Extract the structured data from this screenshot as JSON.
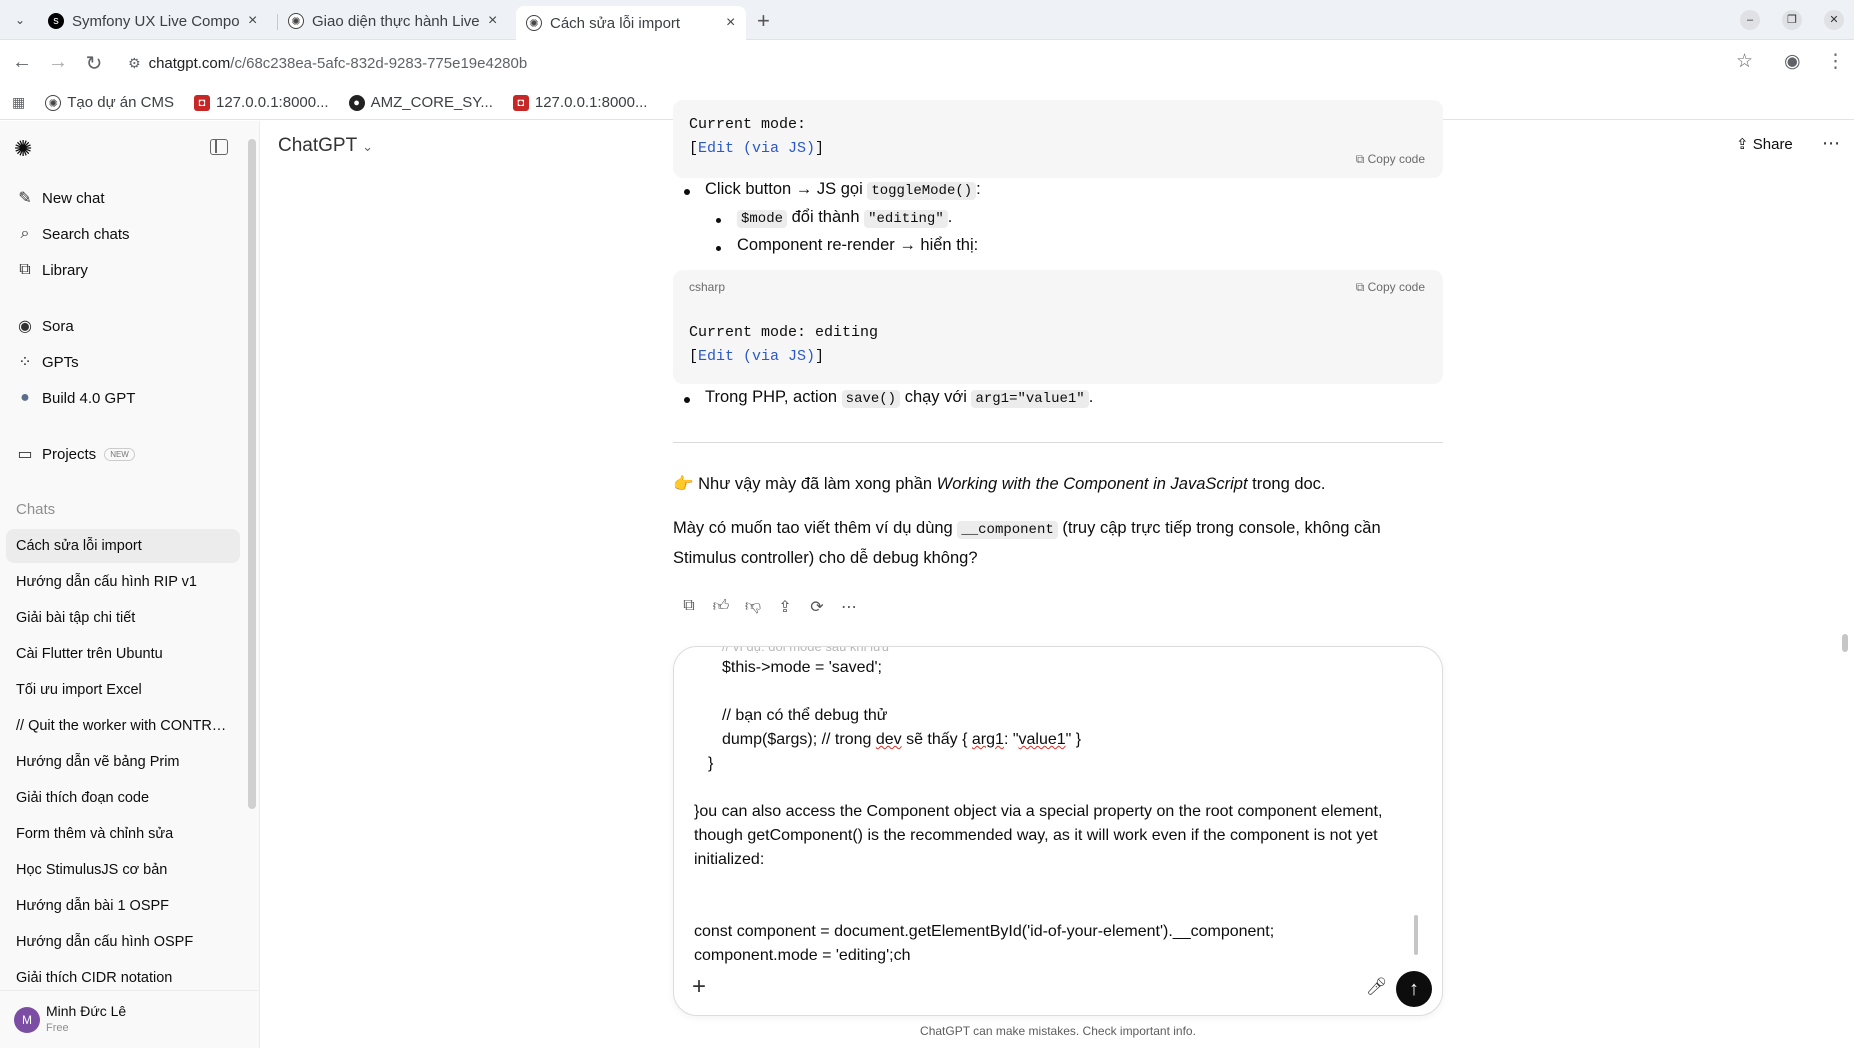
{
  "browser": {
    "tabs": [
      {
        "title": "Symfony UX Live Compon",
        "favicon": "symfony"
      },
      {
        "title": "Giao diện thực hành Live",
        "favicon": "chatgpt"
      },
      {
        "title": "Cách sửa lỗi import",
        "favicon": "chatgpt"
      }
    ],
    "url_host": "chatgpt.com",
    "url_path": "/c/68c238ea-5afc-832d-9283-775e19e4280b",
    "bookmarks": [
      {
        "label": "Tạo dự án CMS",
        "icon": "chatgpt-icon"
      },
      {
        "label": "127.0.0.1:8000...",
        "icon": "app-icon"
      },
      {
        "label": "AMZ_CORE_SY...",
        "icon": "github-icon"
      },
      {
        "label": "127.0.0.1:8000...",
        "icon": "app-icon"
      }
    ]
  },
  "sidebar": {
    "primary": [
      {
        "label": "New chat",
        "icon": "edit-icon"
      },
      {
        "label": "Search chats",
        "icon": "search-icon"
      },
      {
        "label": "Library",
        "icon": "library-icon"
      }
    ],
    "secondary": [
      {
        "label": "Sora",
        "icon": "sora-icon"
      },
      {
        "label": "GPTs",
        "icon": "grid-icon"
      },
      {
        "label": "Build 4.0 GPT",
        "icon": "gpt-avatar-icon"
      }
    ],
    "projects_label": "Projects",
    "projects_badge": "NEW",
    "chats_heading": "Chats",
    "chats": [
      "Cách sửa lỗi import",
      "Hướng dẫn cấu hình RIP v1",
      "Giải bài tập chi tiết",
      "Cài Flutter trên Ubuntu",
      "Tối ưu import Excel",
      "// Quit the worker with CONTR…",
      "Hướng dẫn vẽ bảng Prim",
      "Giải thích đoạn code",
      "Form thêm và chỉnh sửa",
      "Học StimulusJS cơ bản",
      "Hướng dẫn bài 1 OSPF",
      "Hướng dẫn cấu hình OSPF",
      "Giải thích CIDR notation"
    ],
    "user": {
      "initial": "M",
      "name": "Minh Đức Lê",
      "plan": "Free"
    }
  },
  "header": {
    "model": "ChatGPT",
    "share": "Share"
  },
  "message": {
    "code1": {
      "line1": "Current mode:",
      "bracket_open": "[",
      "link": "Edit (via JS)",
      "bracket_close": "]",
      "copy": "Copy code"
    },
    "bullet1": {
      "text_a": "Click button → JS gọi",
      "code": "toggleMode()",
      "text_b": ":"
    },
    "sub1": {
      "code_a": "$mode",
      "text": "đổi thành",
      "code_b": "\"editing\"",
      "end": "."
    },
    "sub2": {
      "text": "Component re-render → hiển thị:"
    },
    "code2": {
      "lang": "csharp",
      "copy": "Copy code",
      "line1": "Current mode: editing",
      "bracket_open": "[",
      "link": "Edit (via JS)",
      "bracket_close": "]"
    },
    "bullet2": {
      "text_a": "Trong PHP, action",
      "code_a": "save()",
      "text_b": "chạy với",
      "code_b": "arg1=\"value1\"",
      "end": "."
    },
    "para1": {
      "emoji": "👉",
      "text_a": "Như vậy mày đã làm xong phần",
      "italic": "Working with the Component in JavaScript",
      "text_b": "trong doc."
    },
    "para2": {
      "text_a": "Mày có muốn tao viết thêm ví dụ dùng",
      "code": "__component",
      "text_b": "(truy cập trực tiếp trong console, không cần Stimulus controller) cho dễ debug không?"
    }
  },
  "composer": {
    "faded_line": "// ví dụ: đổi mode sau khi lưu",
    "line_saved": "$this->mode = 'saved';",
    "line_comment": "// bạn có thể debug thử",
    "dump_a": "dump($args); // trong ",
    "dump_dev": "dev",
    "dump_b": " sẽ thấy { ",
    "dump_arg": "arg1",
    "dump_c": ": \"",
    "dump_val": "value1",
    "dump_d": "\" }",
    "close_brace": "}",
    "prose1": "}ou can also access the Component object via a special property on the root component element,",
    "prose2": "though getComponent() is the recommended way, as it will work even if the component is not yet",
    "prose3": "initialized:",
    "js1": "const component = document.getElementById('id-of-your-element').__component;",
    "js2": "component.mode = 'editing';ch"
  },
  "disclaimer": "ChatGPT can make mistakes. Check important info."
}
